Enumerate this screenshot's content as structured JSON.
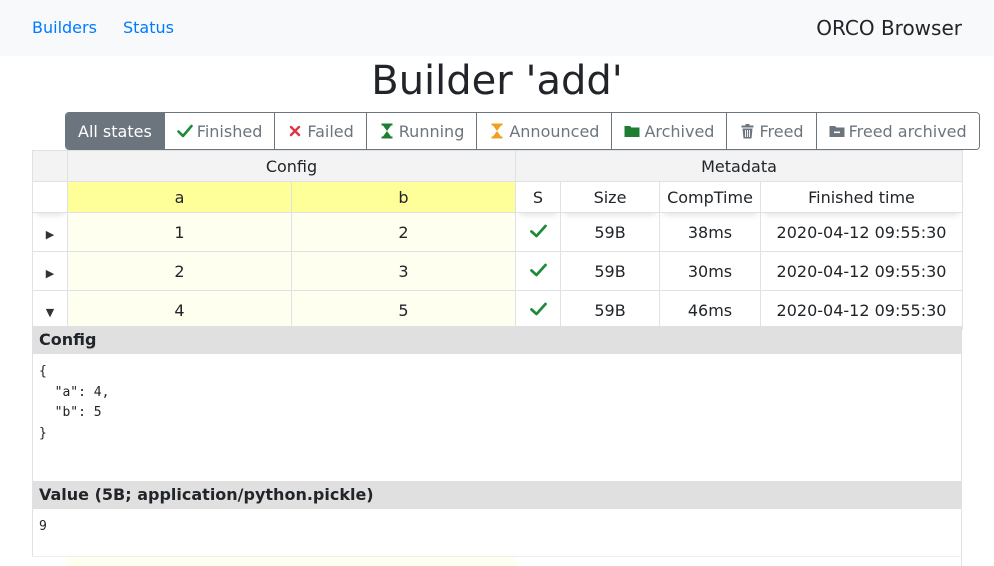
{
  "nav": {
    "links": [
      "Builders",
      "Status"
    ],
    "brand": "ORCO Browser"
  },
  "page_title": "Builder 'add'",
  "filters": [
    {
      "label": "All states",
      "icon": "none",
      "active": true,
      "color": "#ffffff"
    },
    {
      "label": "Finished",
      "icon": "check-icon",
      "active": false,
      "color": "#28a745"
    },
    {
      "label": "Failed",
      "icon": "cross-icon",
      "active": false,
      "color": "#dc3545"
    },
    {
      "label": "Running",
      "icon": "hourglass-icon",
      "active": false,
      "color": "#28a745"
    },
    {
      "label": "Announced",
      "icon": "hourglass-icon",
      "active": false,
      "color": "#f0a020"
    },
    {
      "label": "Archived",
      "icon": "folder-icon",
      "active": false,
      "color": "#1e7e34"
    },
    {
      "label": "Freed",
      "icon": "trash-icon",
      "active": false,
      "color": "#6c757d"
    },
    {
      "label": "Freed archived",
      "icon": "folder-minus-icon",
      "active": false,
      "color": "#6c757d"
    }
  ],
  "table": {
    "groups": {
      "config": "Config",
      "metadata": "Metadata"
    },
    "columns": {
      "a": "a",
      "b": "b",
      "s": "S",
      "size": "Size",
      "comptime": "CompTime",
      "finished": "Finished time"
    },
    "rows": [
      {
        "expanded": false,
        "a": "1",
        "b": "2",
        "status": "finished",
        "size": "59B",
        "comptime": "38ms",
        "finished": "2020-04-12 09:55:30"
      },
      {
        "expanded": false,
        "a": "2",
        "b": "3",
        "status": "finished",
        "size": "59B",
        "comptime": "30ms",
        "finished": "2020-04-12 09:55:30"
      },
      {
        "expanded": true,
        "a": "4",
        "b": "5",
        "status": "finished",
        "size": "59B",
        "comptime": "46ms",
        "finished": "2020-04-12 09:55:30"
      }
    ]
  },
  "detail": {
    "config_heading": "Config",
    "config_body": "{\n  \"a\": 4,\n  \"b\": 5\n}",
    "value_heading": "Value (5B; application/python.pickle)",
    "value_body": "9"
  },
  "colors": {
    "link": "#007bff",
    "check": "#1e8a3a",
    "config_header": "#ffff99",
    "config_cell": "#fffff0",
    "detail_header": "#e0e0e0"
  }
}
